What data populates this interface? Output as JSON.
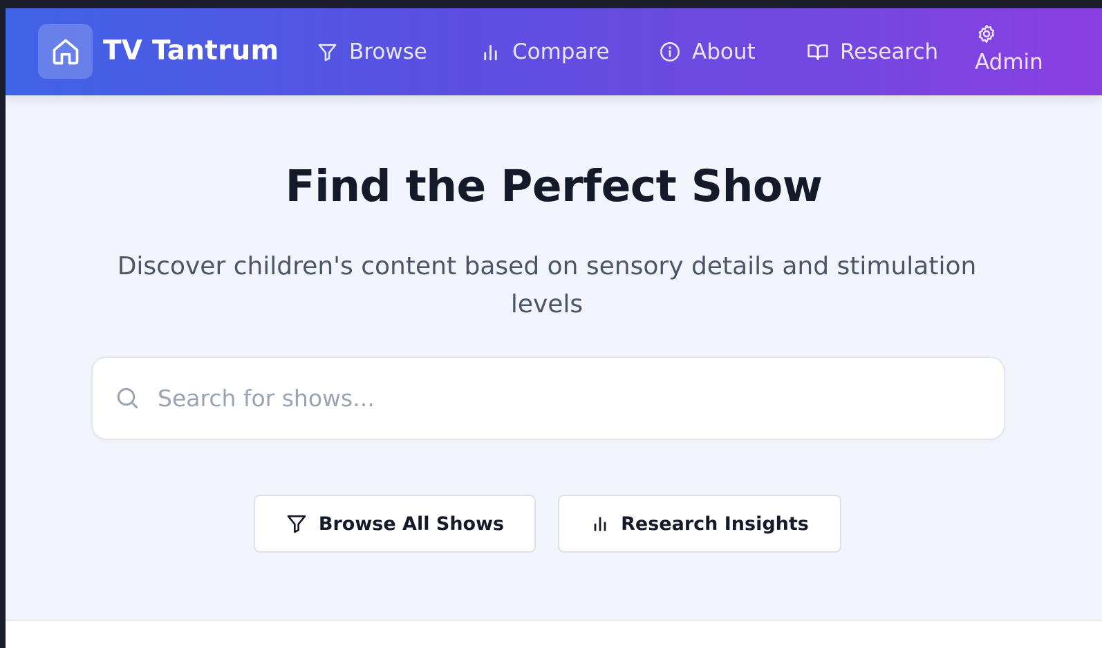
{
  "app": {
    "name": "TV Tantrum"
  },
  "nav": {
    "items": [
      {
        "label": "Browse",
        "icon": "filter-icon"
      },
      {
        "label": "Compare",
        "icon": "bar-chart-icon"
      },
      {
        "label": "About",
        "icon": "info-icon"
      },
      {
        "label": "Research",
        "icon": "book-icon"
      },
      {
        "label": "Admin",
        "icon": "gear-icon"
      }
    ]
  },
  "hero": {
    "title": "Find the Perfect Show",
    "subtitle": "Discover children's content based on sensory details and stimulation levels"
  },
  "search": {
    "placeholder": "Search for shows...",
    "value": ""
  },
  "actions": {
    "browse_label": "Browse All Shows",
    "research_label": "Research Insights"
  },
  "colors": {
    "header_gradient_start": "#3f63e6",
    "header_gradient_end": "#8a3fe2",
    "page_background": "#f3f5fc",
    "title_text": "#141a29",
    "subtitle_text": "#4b5567"
  }
}
